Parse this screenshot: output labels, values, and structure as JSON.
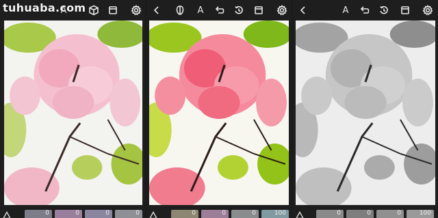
{
  "watermark": "tuhuaba.com",
  "panels": [
    {
      "id": "original",
      "toolbar": {
        "text_tool_label": "A"
      },
      "filter_slots": [
        {
          "value": "0",
          "color": "#7d7d8a"
        },
        {
          "value": "0",
          "color": "#9a7f9c"
        },
        {
          "value": "0",
          "color": "#8a86a0"
        },
        {
          "value": "0",
          "color": "#8f8f96"
        }
      ]
    },
    {
      "id": "enhanced",
      "toolbar": {
        "text_tool_label": "A"
      },
      "filter_slots": [
        {
          "value": "0",
          "color": "#8d8672"
        },
        {
          "value": "0",
          "color": "#9c7e98"
        },
        {
          "value": "0",
          "color": "#8a8d8e"
        },
        {
          "value": "100",
          "color": "#7f9aa0"
        }
      ]
    },
    {
      "id": "grayscale",
      "toolbar": {
        "text_tool_label": "A"
      },
      "filter_slots": [
        {
          "value": "0",
          "color": "#8a8a8a"
        },
        {
          "value": "0",
          "color": "#7e7e7e"
        },
        {
          "value": "0",
          "color": "#909090"
        },
        {
          "value": "100",
          "color": "#9a9a9a"
        }
      ]
    }
  ],
  "colors": {
    "background": "#1a1a1a",
    "blossom_original": "#f2b7c6",
    "blossom_enhanced": "#f06a7e",
    "leaf": "#9cc23c",
    "sky": "#f4f4f4"
  }
}
